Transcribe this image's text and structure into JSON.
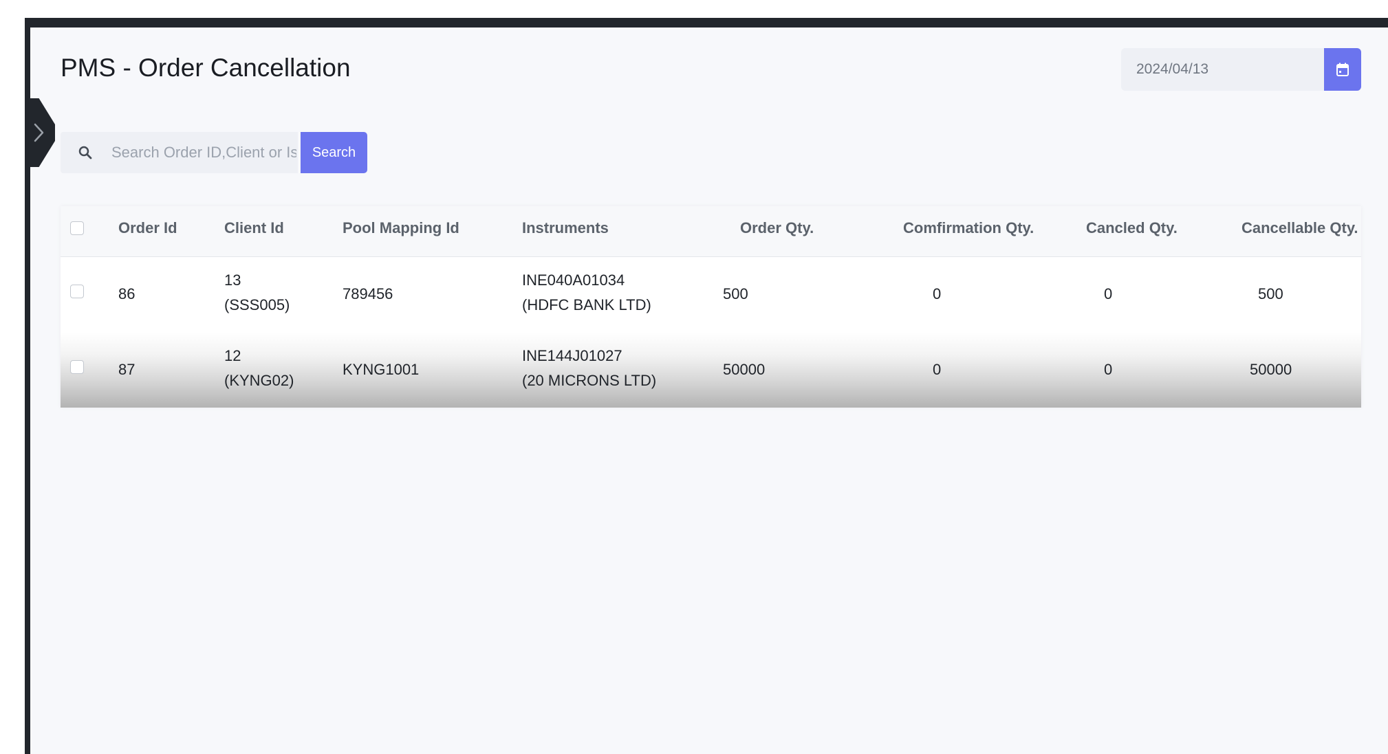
{
  "page": {
    "title": "PMS - Order Cancellation"
  },
  "date_picker": {
    "value": "2024/04/13",
    "button_icon": "calendar-icon"
  },
  "search": {
    "placeholder": "Search Order ID,Client or Is",
    "icon": "search-icon",
    "button_label": "Search"
  },
  "sidebar": {
    "toggle_icon": "chevron-right-icon"
  },
  "table": {
    "headers": {
      "order_id": "Order Id",
      "client_id": "Client Id",
      "pool_mapping_id": "Pool Mapping Id",
      "instruments": "Instruments",
      "order_qty": "Order Qty.",
      "confirmation_qty": "Comfirmation Qty.",
      "cancled_qty": "Cancled Qty.",
      "cancellable_qty": "Cancellable Qty."
    },
    "rows": [
      {
        "order_id": "86",
        "client_id_line1": "13",
        "client_id_line2": "(SSS005)",
        "pool_mapping_id": "789456",
        "instrument_line1": "INE040A01034",
        "instrument_line2": "(HDFC BANK LTD)",
        "order_qty": "500",
        "confirmation_qty": "0",
        "cancled_qty": "0",
        "cancellable_qty": "500"
      },
      {
        "order_id": "87",
        "client_id_line1": "12",
        "client_id_line2": "(KYNG02)",
        "pool_mapping_id": "KYNG1001",
        "instrument_line1": "INE144J01027",
        "instrument_line2": "(20 MICRONS LTD)",
        "order_qty": "50000",
        "confirmation_qty": "0",
        "cancled_qty": "0",
        "cancellable_qty": "50000"
      }
    ]
  },
  "colors": {
    "accent": "#6b74ee",
    "frame": "#22262c",
    "background": "#f7f8fb"
  }
}
